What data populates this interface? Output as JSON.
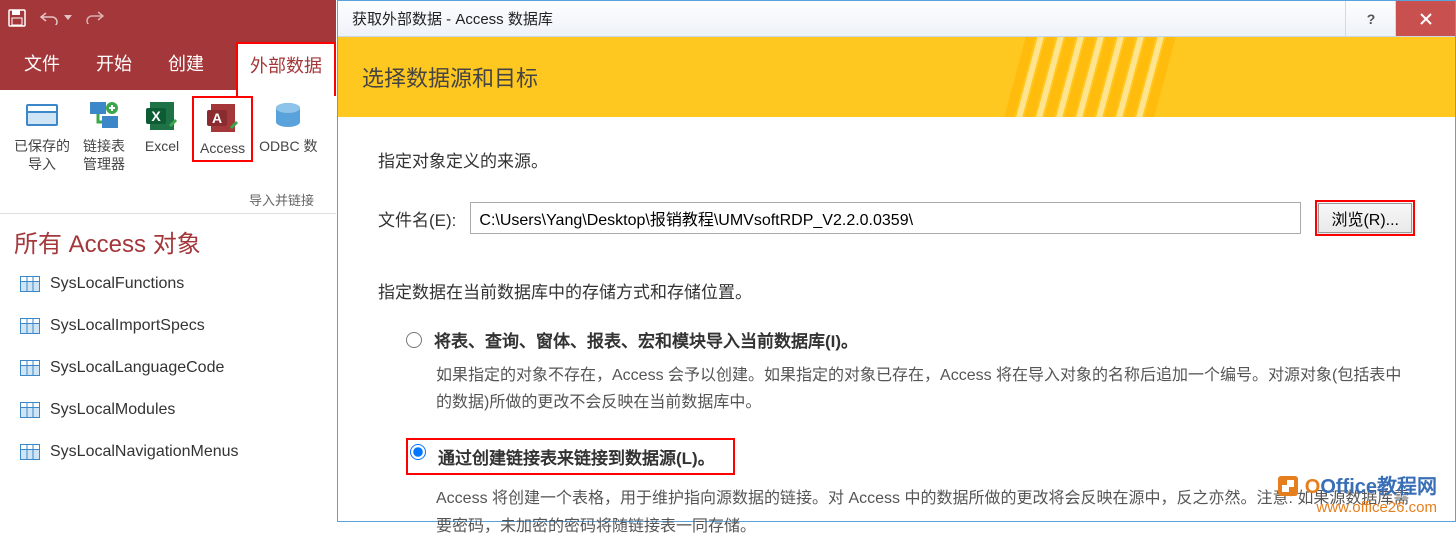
{
  "ribbon": {
    "tabs": {
      "file": "文件",
      "home": "开始",
      "create": "创建",
      "external": "外部数据"
    },
    "buttons": {
      "saved_imports_l1": "已保存的",
      "saved_imports_l2": "导入",
      "linked_mgr_l1": "链接表",
      "linked_mgr_l2": "管理器",
      "excel": "Excel",
      "access": "Access",
      "odbc": "ODBC 数"
    },
    "group_label": "导入并链接"
  },
  "nav": {
    "title": "所有 Access 对象",
    "items": [
      "SysLocalFunctions",
      "SysLocalImportSpecs",
      "SysLocalLanguageCode",
      "SysLocalModules",
      "SysLocalNavigationMenus"
    ]
  },
  "dialog": {
    "title": "获取外部数据 - Access 数据库",
    "banner": "选择数据源和目标",
    "src_label": "指定对象定义的来源。",
    "file_label": "文件名(E):",
    "file_value": "C:\\Users\\Yang\\Desktop\\报销教程\\UMVsoftRDP_V2.2.0.0359\\",
    "browse": "浏览(R)...",
    "storage_label": "指定数据在当前数据库中的存储方式和存储位置。",
    "radio_import_label": "将表、查询、窗体、报表、宏和模块导入当前数据库(I)。",
    "radio_import_desc": "如果指定的对象不存在，Access 会予以创建。如果指定的对象已存在，Access 将在导入对象的名称后追加一个编号。对源对象(包括表中的数据)所做的更改不会反映在当前数据库中。",
    "radio_link_label": "通过创建链接表来链接到数据源(L)。",
    "radio_link_desc": "Access 将创建一个表格，用于维护指向源数据的链接。对 Access 中的数据所做的更改将会反映在源中，反之亦然。注意: 如果源数据库需要密码，未加密的密码将随链接表一同存储。"
  },
  "watermark": {
    "brand_o": "O",
    "brand_rest": "Office教程网",
    "link": "www.office26.com"
  }
}
